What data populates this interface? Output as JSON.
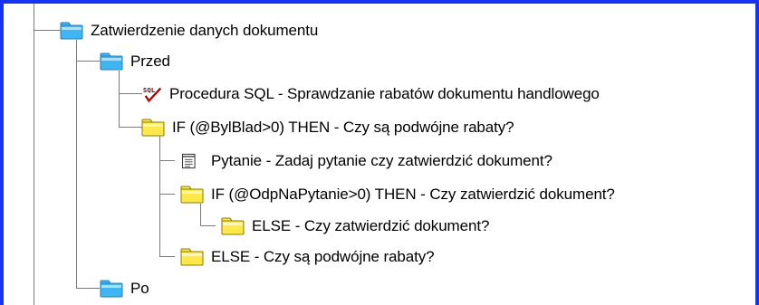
{
  "tree": {
    "root": {
      "label": "Zatwierdzenie danych dokumentu",
      "icon": "folder-blue-icon"
    },
    "przed": {
      "label": "Przed",
      "icon": "folder-blue-icon"
    },
    "procedura": {
      "label": "Procedura SQL - Sprawdzanie rabatów dokumentu handlowego",
      "icon": "sql-procedure-icon"
    },
    "if1": {
      "label": "IF (@BylBlad>0) THEN - Czy są podwójne rabaty?",
      "icon": "folder-yellow-icon"
    },
    "pytanie": {
      "label": "Pytanie - Zadaj pytanie czy zatwierdzić dokument?",
      "icon": "question-dialog-icon"
    },
    "if2": {
      "label": "IF (@OdpNaPytanie>0) THEN - Czy zatwierdzić dokument?",
      "icon": "folder-yellow-icon"
    },
    "else2": {
      "label": "ELSE - Czy zatwierdzić dokument?",
      "icon": "folder-yellow-icon"
    },
    "else1": {
      "label": "ELSE - Czy są podwójne rabaty?",
      "icon": "folder-yellow-icon"
    },
    "po": {
      "label": "Po",
      "icon": "folder-blue-icon"
    }
  },
  "colors": {
    "frame": "#1533f0",
    "folder_blue": "#3fb6f2",
    "folder_yellow": "#ffe84a",
    "connector": "#7a7a7a",
    "sql_text": "#800000",
    "checkmark": "#b00000"
  }
}
